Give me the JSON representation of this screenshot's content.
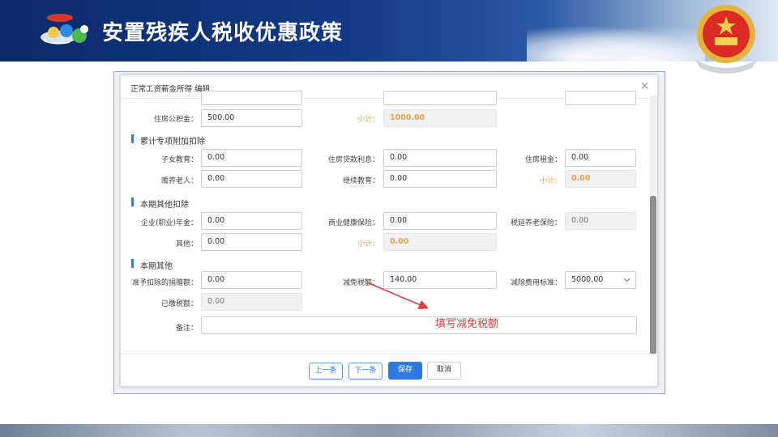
{
  "header": {
    "title": "安置残疾人税收优惠政策",
    "logo_icon": "tax-mascot-logo",
    "emblem_icon": "national-emblem",
    "colors": {
      "banner_dark": "#0b2a6b",
      "accent_blue": "#2d7be0",
      "annotation_red": "#e23a3a",
      "subtotal_orange": "#f0a040"
    }
  },
  "dialog": {
    "title": "正常工资薪金所得 编辑",
    "close_glyph": "×",
    "row_top": {
      "housing_fund_label": "住房公积金：",
      "housing_fund_value": "500.00",
      "subtotal_label": "小计：",
      "subtotal_value": "1000.00"
    },
    "special_deductions": {
      "heading": "累计专项附加扣除",
      "children_edu_label": "子女教育：",
      "children_edu_value": "0.00",
      "mortgage_label": "住房贷款利息：",
      "mortgage_value": "0.00",
      "rent_label": "住房租金：",
      "rent_value": "0.00",
      "elderly_label": "赡养老人：",
      "elderly_value": "0.00",
      "continuing_edu_label": "继续教育：",
      "continuing_edu_value": "0.00",
      "subtotal_label": "小计：",
      "subtotal_value": "0.00"
    },
    "other_deductions": {
      "heading": "本期其他扣除",
      "annuity_label": "企业(职业)年金：",
      "annuity_value": "0.00",
      "health_ins_label": "商业健康保险：",
      "health_ins_value": "0.00",
      "pension_label": "税延养老保险：",
      "pension_value": "0.00",
      "other_label": "其他：",
      "other_value": "0.00",
      "subtotal_label": "小计：",
      "subtotal_value": "0.00"
    },
    "period_other": {
      "heading": "本期其他",
      "donation_label": "准予扣除的捐赠额：",
      "donation_value": "0.00",
      "tax_relief_label": "减免税额：",
      "tax_relief_value": "140.00",
      "standard_label": "减除费用标准：",
      "standard_value": "5000.00",
      "paid_tax_label": "已缴税额：",
      "paid_tax_value": "0.00",
      "remark_label": "备注：",
      "remark_value": ""
    },
    "buttons": {
      "prev": "上一条",
      "next": "下一条",
      "save": "保存",
      "cancel": "取消"
    }
  },
  "annotation": {
    "text": "填写减免税额"
  }
}
